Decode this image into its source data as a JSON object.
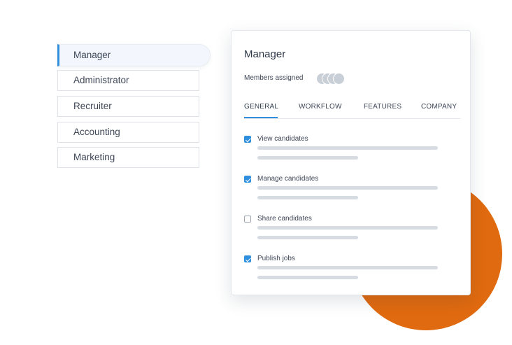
{
  "roles": [
    {
      "label": "Manager",
      "active": true
    },
    {
      "label": "Administrator",
      "active": false
    },
    {
      "label": "Recruiter",
      "active": false
    },
    {
      "label": "Accounting",
      "active": false
    },
    {
      "label": "Marketing",
      "active": false
    }
  ],
  "panel": {
    "title": "Manager",
    "members_label": "Members assigned",
    "member_avatar_count": 4,
    "tabs": [
      {
        "label": "GENERAL",
        "active": true
      },
      {
        "label": "WORKFLOW",
        "active": false
      },
      {
        "label": "FEATURES",
        "active": false
      },
      {
        "label": "COMPANY",
        "active": false
      }
    ],
    "permissions": [
      {
        "label": "View candidates",
        "checked": true
      },
      {
        "label": "Manage candidates",
        "checked": true
      },
      {
        "label": "Share candidates",
        "checked": false
      },
      {
        "label": "Publish jobs",
        "checked": true
      }
    ]
  },
  "colors": {
    "accent": "#2f8fdc",
    "decor_circle": "#e06a0f",
    "placeholder_bar": "#d7dce2"
  }
}
